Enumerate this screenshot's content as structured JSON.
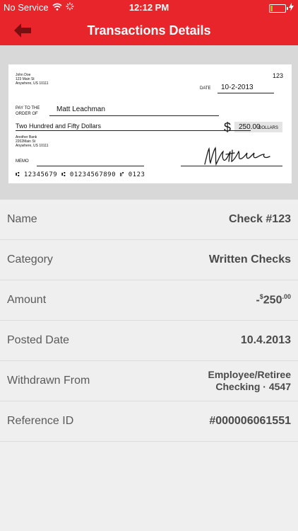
{
  "status_bar": {
    "carrier": "No Service",
    "time": "12:12 PM",
    "battery_level": 0.15
  },
  "nav": {
    "title": "Transactions Details",
    "back_icon": "back-arrow-icon"
  },
  "check": {
    "payer_name": "John Doe",
    "payer_address1": "123 Main St",
    "payer_address2": "Anywhere, US 10111",
    "check_number": "123",
    "date_label": "DATE",
    "date_value": "10-2-2013",
    "pay_to_label1": "PAY TO THE",
    "pay_to_label2": "ORDER OF",
    "payee": "Matt Leachman",
    "currency_symbol": "$",
    "amount_numeric": "250.00",
    "amount_words": "Two Hundred and Fifty Dollars",
    "dollars_label": "DOLLARS",
    "bank_name": "Another Bank",
    "bank_address1": "2202Main St",
    "bank_address2": "Anywhere, US 10111",
    "memo_label": "MEMO",
    "micr_line": "⑆ 12345679 ⑆ 01234567890 ⑈ 0123",
    "signature": "Matt Leachman"
  },
  "details": {
    "name_label": "Name",
    "name_value": "Check #123",
    "category_label": "Category",
    "category_value": "Written Checks",
    "amount_label": "Amount",
    "amount_prefix": "-",
    "amount_currency": "$",
    "amount_whole": "250",
    "amount_cents": ".00",
    "posted_label": "Posted Date",
    "posted_value": "10.4.2013",
    "withdrawn_label": "Withdrawn From",
    "withdrawn_line1": "Employee/Retiree",
    "withdrawn_line2": "Checking · 4547",
    "reference_label": "Reference ID",
    "reference_value": "#000006061551"
  }
}
